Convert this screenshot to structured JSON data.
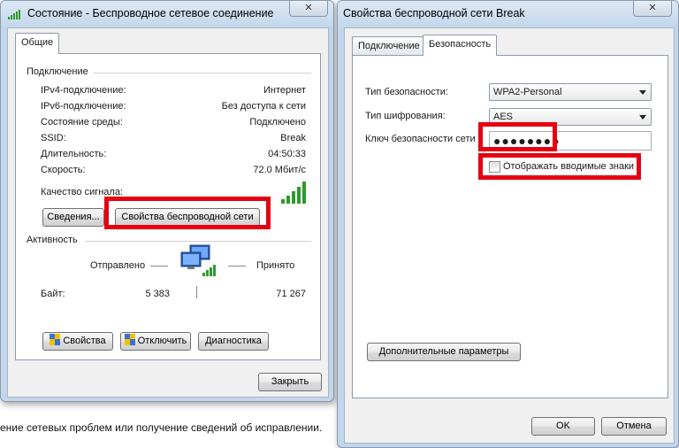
{
  "background": {
    "status_text": "ение сетевых проблем или получение сведений об исправлении."
  },
  "status_window": {
    "title": "Состояние - Беспроводное сетевое соединение",
    "close_glyph": "✕",
    "tab": "Общие",
    "connection": {
      "heading": "Подключение",
      "rows": [
        {
          "label": "IPv4-подключение:",
          "value": "Интернет"
        },
        {
          "label": "IPv6-подключение:",
          "value": "Без доступа к сети"
        },
        {
          "label": "Состояние среды:",
          "value": "Подключено"
        },
        {
          "label": "SSID:",
          "value": "Break"
        },
        {
          "label": "Длительность:",
          "value": "04:50:33"
        },
        {
          "label": "Скорость:",
          "value": "72.0 Мбит/с"
        }
      ],
      "signal_label": "Качество сигнала:",
      "details_button": "Сведения...",
      "wireless_props_button": "Свойства беспроводной сети"
    },
    "activity": {
      "heading": "Активность",
      "sent_label": "Отправлено",
      "received_label": "Принято",
      "bytes_label": "Байт:",
      "bytes_sent": "5 383",
      "bytes_received": "71 267"
    },
    "buttons": {
      "properties": "Свойства",
      "disable": "Отключить",
      "diagnostics": "Диагностика",
      "close": "Закрыть"
    }
  },
  "props_window": {
    "title": "Свойства беспроводной сети Break",
    "close_glyph": "✕",
    "tabs": [
      "Подключение",
      "Безопасность"
    ],
    "security_type_label": "Тип безопасности:",
    "security_type_value": "WPA2-Personal",
    "encryption_type_label": "Тип шифрования:",
    "encryption_type_value": "AES",
    "key_label": "Ключ безопасности сети",
    "key_value": "●●●●●●●●",
    "show_chars_label": "Отображать вводимые знаки",
    "show_chars_checked": false,
    "advanced_button": "Дополнительные параметры",
    "ok_button": "OK",
    "cancel_button": "Отмена"
  },
  "colors": {
    "highlight": "#e50012",
    "signal_green": "#2e9a2e"
  }
}
